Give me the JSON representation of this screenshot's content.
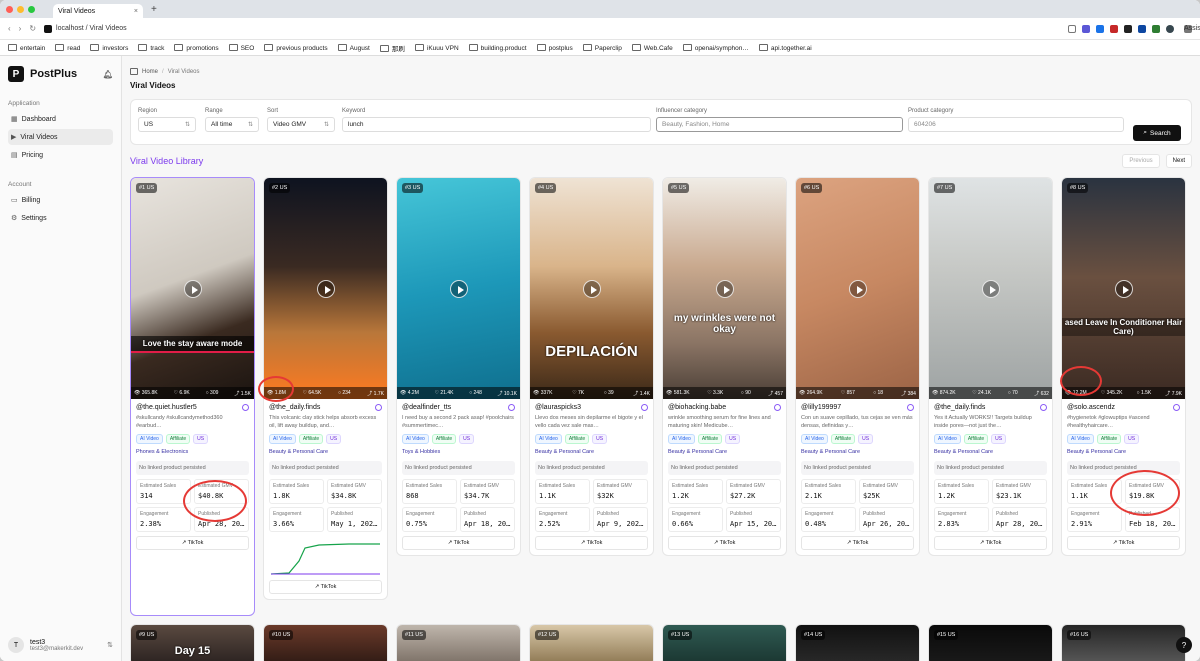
{
  "browser": {
    "tab_title": "Viral Videos",
    "url": "localhost / Viral Videos",
    "assistant": "Assistant",
    "bookmarks": [
      "entertain",
      "read",
      "investors",
      "track",
      "promotions",
      "SEO",
      "previous products",
      "August",
      "那刷",
      "iKuuu VPN",
      "building.product",
      "postplus",
      "Paperclip",
      "Web.Cafe",
      "openai/symphon…",
      "api.together.ai"
    ]
  },
  "sidebar": {
    "brand": "PostPlus",
    "section_app": "Application",
    "items": [
      {
        "label": "Dashboard",
        "icon": "dashboard-icon"
      },
      {
        "label": "Viral Videos",
        "icon": "video-icon"
      },
      {
        "label": "Pricing",
        "icon": "pricing-icon"
      }
    ],
    "section_account": "Account",
    "account_items": [
      {
        "label": "Billing"
      },
      {
        "label": "Settings"
      }
    ],
    "user": {
      "initial": "T",
      "name": "test3",
      "email": "test3@makerkit.dev"
    }
  },
  "header": {
    "breadcrumb_home": "Home",
    "breadcrumb_current": "Viral Videos",
    "title": "Viral Videos"
  },
  "filters": {
    "region": {
      "label": "Region",
      "value": "US"
    },
    "range": {
      "label": "Range",
      "value": "All time"
    },
    "sort": {
      "label": "Sort",
      "value": "Video GMV"
    },
    "keyword": {
      "label": "Keyword",
      "value": "lunch"
    },
    "influencer": {
      "label": "Influencer category",
      "placeholder": "Beauty, Fashion, Home"
    },
    "product": {
      "label": "Product category",
      "placeholder": "604206"
    },
    "search_label": "Search"
  },
  "library": {
    "title": "Viral Video Library",
    "previous": "Previous",
    "next": "Next"
  },
  "labels": {
    "ai": "AI Video",
    "affiliate": "Affiliate",
    "no_link": "No linked product persisted",
    "est_sales": "Estimated Sales",
    "est_gmv": "Estimated GMV",
    "engagement": "Engagement",
    "published": "Published",
    "tiktok": "TikTok"
  },
  "cards": [
    {
      "rank": "#1 US",
      "views": "365.8K",
      "likes": "6.9K",
      "comments": "309",
      "shares": "1.5K",
      "caption": "Love the stay aware mode",
      "handle": "@the.quiet.hustler5",
      "desc": "#skullcandy #skullcandymethod360 #earbud…",
      "region": "US",
      "category": "Phones & Electronics",
      "sales": "314",
      "gmv": "$40.8K",
      "engagement": "2.38%",
      "published": "Apr 28, 20…",
      "bg": "linear-gradient(160deg,#e8e4de 0%,#cfc9c0 45%,#3a2a20 70%,#1b1410 100%)"
    },
    {
      "rank": "#2 US",
      "views": "1.8M",
      "likes": "64.5K",
      "comments": "234",
      "shares": "1.7K",
      "caption": "",
      "handle": "@the_daily.finds",
      "desc": "This volcanic clay stick helps absorb excess oil, lift away buildup, and…",
      "region": "US",
      "category": "Beauty & Personal Care",
      "sales": "1.8K",
      "gmv": "$34.8K",
      "engagement": "3.66%",
      "published": "May 1, 202…",
      "bg": "linear-gradient(180deg,#0e1320 0%,#3a2a22 40%,#b9773a 70%,#ff7a20 100%)"
    },
    {
      "rank": "#3 US",
      "views": "4.2M",
      "likes": "21.4K",
      "comments": "248",
      "shares": "10.1K",
      "caption": "",
      "handle": "@dealfinder_tts",
      "desc": "I need buy a second 2 pack asap! #poolchairs #summertimec…",
      "region": "US",
      "category": "Toys & Hobbies",
      "sales": "868",
      "gmv": "$34.7K",
      "engagement": "0.75%",
      "published": "Apr 18, 20…",
      "bg": "linear-gradient(170deg,#46c6d8 0%,#1d98b9 50%,#0f6f8e 100%)"
    },
    {
      "rank": "#4 US",
      "views": "337K",
      "likes": "7K",
      "comments": "39",
      "shares": "1.4K",
      "caption": "DEPILACIÓN",
      "handle": "@lauraspicks3",
      "desc": "Llevo dos meses sin depilarme el bigote y el vello cada vez sale mas…",
      "region": "US",
      "category": "Beauty & Personal Care",
      "sales": "1.1K",
      "gmv": "$32K",
      "engagement": "2.52%",
      "published": "Apr 9, 202…",
      "bg": "linear-gradient(180deg,#efe3d4 0%,#d9b48a 40%,#8a5a30 70%,#3a2818 100%)"
    },
    {
      "rank": "#5 US",
      "views": "581.3K",
      "likes": "3.3K",
      "comments": "90",
      "shares": "457",
      "caption": "my wrinkles were not okay",
      "handle": "@biohacking.babe",
      "desc": "wrinkle smoothing serum for fine lines and maturing skin! Medicube…",
      "region": "US",
      "category": "Beauty & Personal Care",
      "sales": "1.2K",
      "gmv": "$27.2K",
      "engagement": "0.66%",
      "published": "Apr 15, 20…",
      "bg": "linear-gradient(180deg,#f0ece6 0%,#c9a98e 40%,#8a7464 75%,#4a3e36 100%)"
    },
    {
      "rank": "#6 US",
      "views": "264.9K",
      "likes": "857",
      "comments": "18",
      "shares": "384",
      "caption": "",
      "handle": "@lilly199997",
      "desc": "Con un suave cepillado, tus cejas se ven más densas, definidas y…",
      "region": "US",
      "category": "Beauty & Personal Care",
      "sales": "2.1K",
      "gmv": "$25K",
      "engagement": "0.48%",
      "published": "Apr 26, 20…",
      "bg": "linear-gradient(160deg,#dca380 0%,#c78862 50%,#9c6446 100%)"
    },
    {
      "rank": "#7 US",
      "views": "874.2K",
      "likes": "24.1K",
      "comments": "70",
      "shares": "632",
      "caption": "",
      "handle": "@the_daily.finds",
      "desc": "Yes it Actually WORKS!! Targets buildup inside pores—not just the…",
      "region": "US",
      "category": "Beauty & Personal Care",
      "sales": "1.2K",
      "gmv": "$23.1K",
      "engagement": "2.83%",
      "published": "Apr 28, 20…",
      "bg": "linear-gradient(180deg,#dfe3e4 0%,#c7c9c6 40%,#9ea3a3 100%)"
    },
    {
      "rank": "#8 US",
      "views": "12.2M",
      "likes": "345.2K",
      "comments": "1.5K",
      "shares": "7.9K",
      "caption": "ased Leave In Conditioner Hair Care)",
      "handle": "@solo.ascendz",
      "desc": "#hygienetok #glowuptips #ascend #healthyhaircare…",
      "region": "US",
      "category": "Beauty & Personal Care",
      "sales": "1.1K",
      "gmv": "$19.8K",
      "engagement": "2.91%",
      "published": "Feb 18, 20…",
      "bg": "linear-gradient(180deg,#2a3340 0%,#6a5040 45%,#3b2a22 100%)"
    }
  ],
  "row2": [
    {
      "rank": "#9 US",
      "caption": "Day 15",
      "bg": "linear-gradient(180deg,#5a4a40,#2a2220)"
    },
    {
      "rank": "#10 US",
      "caption": "",
      "bg": "linear-gradient(180deg,#6b3a2a,#2e1a14)"
    },
    {
      "rank": "#11 US",
      "caption": "",
      "bg": "linear-gradient(180deg,#bfb6ac,#7a6e64)"
    },
    {
      "rank": "#12 US",
      "caption": "",
      "bg": "linear-gradient(180deg,#d8c7a8,#8c7650)"
    },
    {
      "rank": "#13 US",
      "caption": "",
      "bg": "linear-gradient(180deg,#2f5a52,#1a3530)"
    },
    {
      "rank": "#14 US",
      "caption": "",
      "bg": "linear-gradient(180deg,#111,#2a2a2a)"
    },
    {
      "rank": "#15 US",
      "caption": "",
      "bg": "linear-gradient(180deg,#0a0a0a,#1a1a1a)"
    },
    {
      "rank": "#16 US",
      "caption": "",
      "bg": "linear-gradient(180deg,#262626,#5a5a5a)"
    }
  ]
}
